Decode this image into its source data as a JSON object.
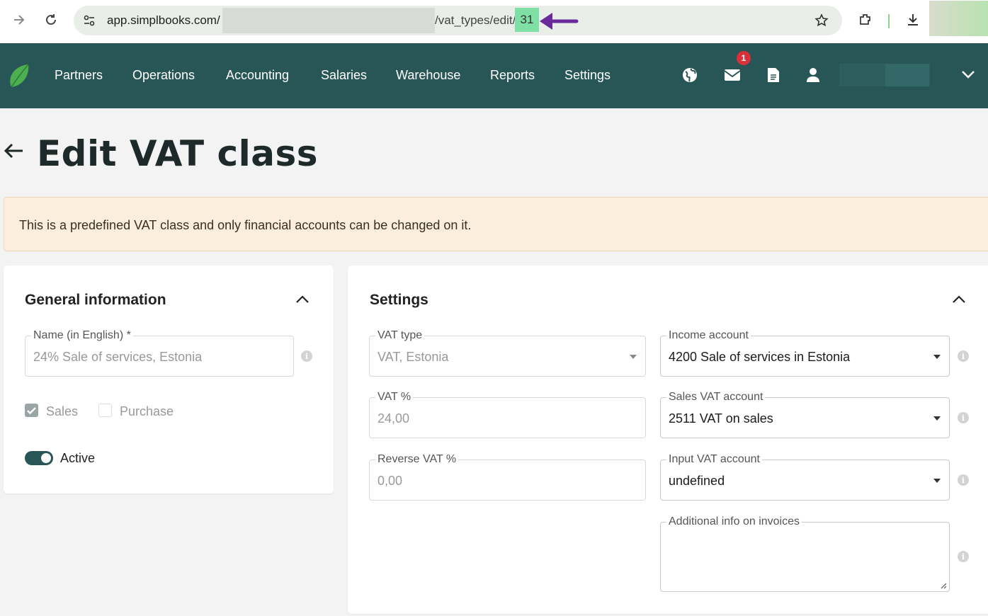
{
  "browser": {
    "url_host": "app.simplbooks.com/",
    "url_path": "/vat_types/edit/",
    "url_id": "31"
  },
  "nav": {
    "items": [
      "Partners",
      "Operations",
      "Accounting",
      "Salaries",
      "Warehouse",
      "Reports",
      "Settings"
    ],
    "mail_badge": "1",
    "icons": [
      "globe-icon",
      "mail-icon",
      "document-icon",
      "user-icon",
      "chevron-down-icon"
    ]
  },
  "page": {
    "title": "Edit VAT class"
  },
  "alert": {
    "text": "This is a predefined VAT class and only financial accounts can be changed on it."
  },
  "general": {
    "title": "General information",
    "name_label": "Name (in English) *",
    "name_value": "24% Sale of services, Estonia",
    "sales_label": "Sales",
    "sales_checked": true,
    "purchase_label": "Purchase",
    "purchase_checked": false,
    "active_label": "Active",
    "active_on": true
  },
  "settings": {
    "title": "Settings",
    "vat_type_label": "VAT type",
    "vat_type_value": "VAT, Estonia",
    "vat_pct_label": "VAT %",
    "vat_pct_value": "24,00",
    "reverse_vat_label": "Reverse VAT %",
    "reverse_vat_value": "0,00",
    "income_account_label": "Income account",
    "income_account_value": "4200 Sale of services in Estonia",
    "sales_vat_label": "Sales VAT account",
    "sales_vat_value": "2511 VAT on sales",
    "input_vat_label": "Input VAT account",
    "input_vat_value": "undefined",
    "additional_info_label": "Additional info on invoices",
    "additional_info_value": ""
  },
  "colors": {
    "nav_bg": "#285656",
    "accent_highlight": "#7ee0a4",
    "annotation_arrow": "#6a2a9a",
    "alert_bg": "#fbeedd",
    "badge": "#d9303a"
  }
}
